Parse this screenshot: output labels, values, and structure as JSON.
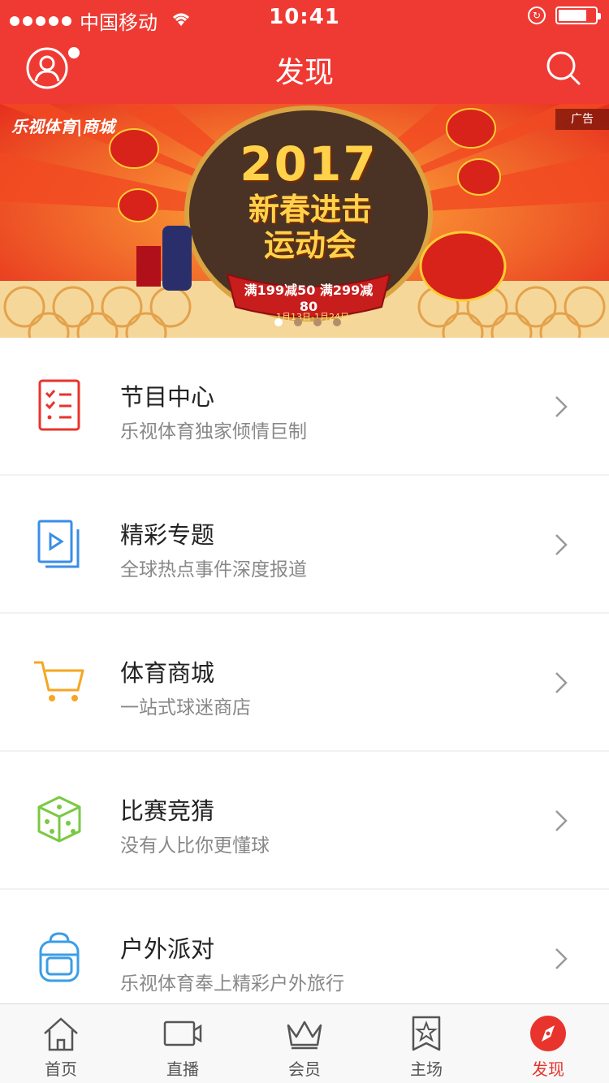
{
  "status_bar": {
    "carrier": "中国移动",
    "time": "10:41"
  },
  "header": {
    "title": "发现",
    "avatar_icon": "user-avatar-icon",
    "search_icon": "search-icon"
  },
  "banner": {
    "brand": "乐视体育|商城",
    "ad_label": "广告",
    "title": "2017",
    "subtitle_line1": "新春进击",
    "subtitle_line2": "运动会",
    "promo": "满199减50 满299减80",
    "date": "1月13日-1月24日",
    "colors": {
      "bg": "#e8321f",
      "gold": "#ffd24a"
    }
  },
  "list": [
    {
      "title": "节目中心",
      "subtitle": "乐视体育独家倾情巨制",
      "icon": "checklist-icon",
      "color": "#e8342c"
    },
    {
      "title": "精彩专题",
      "subtitle": "全球热点事件深度报道",
      "icon": "video-folder-icon",
      "color": "#3a8ee6"
    },
    {
      "title": "体育商城",
      "subtitle": "一站式球迷商店",
      "icon": "shopping-cart-icon",
      "color": "#f5a623"
    },
    {
      "title": "比赛竞猜",
      "subtitle": "没有人比你更懂球",
      "icon": "dice-icon",
      "color": "#7ac943"
    },
    {
      "title": "户外派对",
      "subtitle": "乐视体育奉上精彩户外旅行",
      "icon": "backpack-icon",
      "color": "#3a9ee6"
    }
  ],
  "tabbar": [
    {
      "label": "首页",
      "icon": "home-icon"
    },
    {
      "label": "直播",
      "icon": "video-camera-icon"
    },
    {
      "label": "会员",
      "icon": "crown-icon"
    },
    {
      "label": "主场",
      "icon": "star-badge-icon"
    },
    {
      "label": "发现",
      "icon": "compass-icon",
      "active": true
    }
  ],
  "colors": {
    "brand_red": "#ef3a33",
    "active_tab": "#e8342c"
  }
}
